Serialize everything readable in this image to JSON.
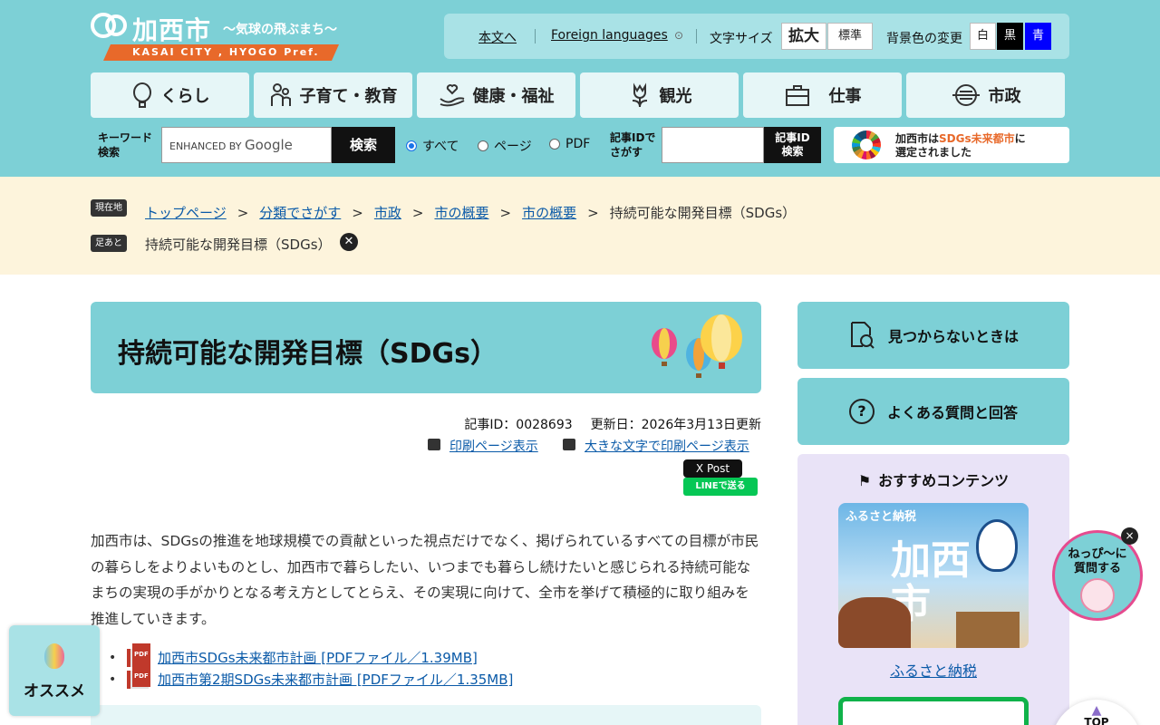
{
  "header": {
    "city_name": "加西市",
    "tagline": "〜気球の飛ぶまち〜",
    "band_text": "KASAI CITY , HYOGO Pref.",
    "util": {
      "skip_link": "本文へ",
      "foreign": "Foreign languages",
      "font_size_label": "文字サイズ",
      "font_large": "拡大",
      "font_normal": "標準",
      "bg_label": "背景色の変更",
      "bg_white": "白",
      "bg_black": "黒",
      "bg_blue": "青"
    },
    "nav": [
      {
        "label": "くらし",
        "icon": "balloon-icon"
      },
      {
        "label": "子育て・教育",
        "icon": "family-icon"
      },
      {
        "label": "健康・福祉",
        "icon": "hands-heart-icon"
      },
      {
        "label": "観光",
        "icon": "tulip-icon"
      },
      {
        "label": "仕事",
        "icon": "briefcase-icon"
      },
      {
        "label": "市政",
        "icon": "city-icon"
      }
    ],
    "search": {
      "keyword_label_1": "キーワード",
      "keyword_label_2": "検索",
      "input_placeholder": "ENHANCED BY",
      "google": "Google",
      "search_button": "検索",
      "radio_all": "すべて",
      "radio_page": "ページ",
      "radio_pdf": "PDF",
      "selected_radio": "すべて",
      "id_label_1": "記事IDで",
      "id_label_2": "さがす",
      "id_button_1": "記事ID",
      "id_button_2": "検索"
    },
    "sdgs_banner": {
      "line1_a": "加西市は",
      "line1_b": "SDGs未来都市",
      "line1_c": "に",
      "line2": "選定されました"
    }
  },
  "breadcrumb": {
    "current_tag": "現在地",
    "trail_tag": "足あと",
    "items": [
      "トップページ",
      "分類でさがす",
      "市政",
      "市の概要",
      "市の概要"
    ],
    "current": "持続可能な開発目標（SDGs）",
    "trail_item": "持続可能な開発目標（SDGs）"
  },
  "article": {
    "title": "持続可能な開発目標（SDGs）",
    "article_id": "記事ID：0028693",
    "updated": "更新日：2026年3月13日更新",
    "print_link": "印刷ページ表示",
    "print_large_link": "大きな文字で印刷ページ表示",
    "x_post": "X Post",
    "line_send": "LINEで送る",
    "body": "加西市は、SDGsの推進を地球規模での貢献といった視点だけでなく、掲げられているすべての目標が市民の暮らしをよりよいものとし、加西市で暮らしたい、いつまでも暮らし続けたいと感じられる持続可能なまちの実現の手がかりとなる考え方としてとらえ、その実現に向けて、全市を挙げて積極的に取り組みを推進していきます。",
    "files": [
      "加西市SDGs未来都市計画 [PDFファイル／1.39MB]",
      "加西市第2期SDGs未来都市計画 [PDFファイル／1.35MB]"
    ],
    "pdf_badge": "PDF"
  },
  "sidebar": {
    "not_found": "見つからないときは",
    "faq": "よくある質問と回答",
    "recommend_title": "おすすめコンテンツ",
    "recommend_image": {
      "small": "ふるさと納税",
      "big_1": "加西",
      "big_2": "市"
    },
    "recommend_link": "ふるさと納税"
  },
  "floating": {
    "chat_1": "ねっぴ〜に",
    "chat_2": "質問する",
    "close": "×",
    "totop": "TOP",
    "osusume": "オススメ"
  },
  "colors": {
    "header_bg": "#7dd0d6",
    "breadcrumb_bg": "#fdf4dc",
    "accent_orange": "#e8692a",
    "link": "#0a5aa8"
  }
}
